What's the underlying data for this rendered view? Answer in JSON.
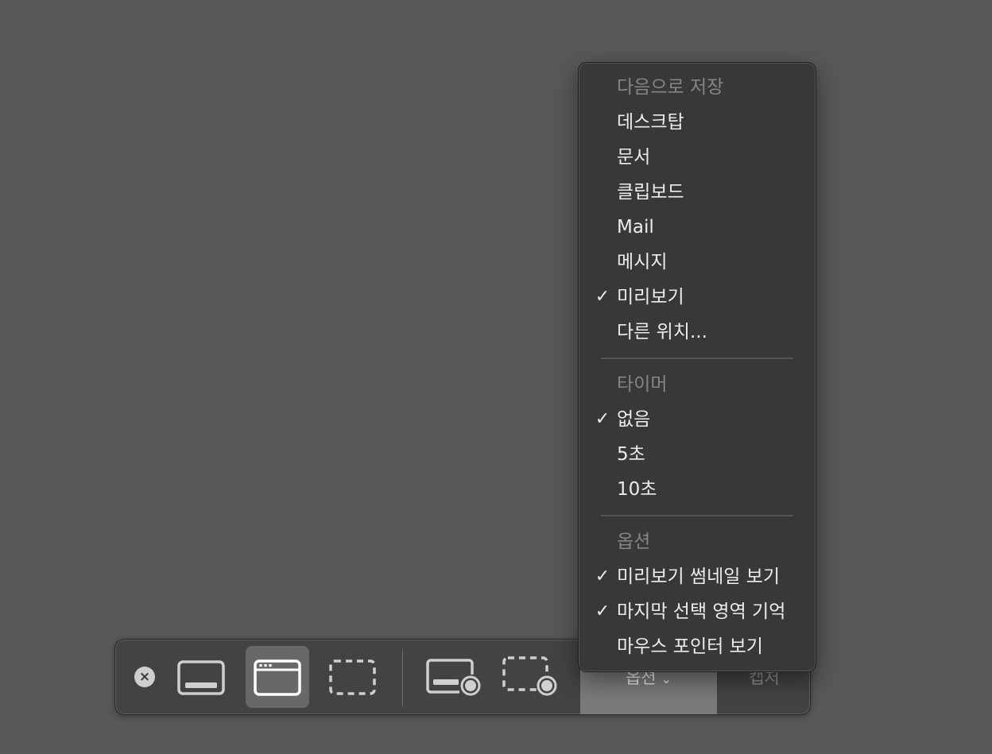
{
  "toolbar": {
    "close_icon": "close-icon",
    "buttons": [
      {
        "name": "capture-entire-screen",
        "icon": "screen-icon",
        "selected": false
      },
      {
        "name": "capture-selected-window",
        "icon": "window-icon",
        "selected": true
      },
      {
        "name": "capture-selected-portion",
        "icon": "dashed-rect-icon",
        "selected": false
      },
      {
        "name": "record-entire-screen",
        "icon": "screen-record-icon",
        "selected": false
      },
      {
        "name": "record-selected-portion",
        "icon": "dashed-rect-record-icon",
        "selected": false
      }
    ],
    "options_label": "옵션",
    "options_chevron": "⌄",
    "capture_label": "캡처"
  },
  "menu": {
    "save_to": {
      "header": "다음으로 저장",
      "items": [
        {
          "label": "데스크탑",
          "checked": false
        },
        {
          "label": "문서",
          "checked": false
        },
        {
          "label": "클립보드",
          "checked": false
        },
        {
          "label": "Mail",
          "checked": false
        },
        {
          "label": "메시지",
          "checked": false
        },
        {
          "label": "미리보기",
          "checked": true
        },
        {
          "label": "다른 위치...",
          "checked": false
        }
      ]
    },
    "timer": {
      "header": "타이머",
      "items": [
        {
          "label": "없음",
          "checked": true
        },
        {
          "label": "5초",
          "checked": false
        },
        {
          "label": "10초",
          "checked": false
        }
      ]
    },
    "options": {
      "header": "옵션",
      "items": [
        {
          "label": "미리보기 썸네일 보기",
          "checked": true
        },
        {
          "label": "마지막 선택 영역 기억",
          "checked": true
        },
        {
          "label": "마우스 포인터 보기",
          "checked": false
        }
      ]
    },
    "check_glyph": "✓"
  }
}
